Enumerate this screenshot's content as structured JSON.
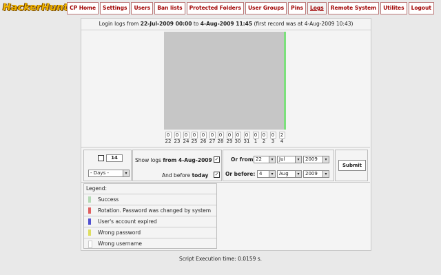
{
  "app": {
    "logo_text": "HackerHunter"
  },
  "nav": [
    {
      "label": "CP Home",
      "active": false
    },
    {
      "label": "Settings",
      "active": false
    },
    {
      "label": "Users",
      "active": false
    },
    {
      "label": "Ban lists",
      "active": false
    },
    {
      "label": "Protected Folders",
      "active": false
    },
    {
      "label": "User Groups",
      "active": false
    },
    {
      "label": "Pins",
      "active": false
    },
    {
      "label": "Logs",
      "active": true
    },
    {
      "label": "Remote System",
      "active": false
    },
    {
      "label": "Utilites",
      "active": false
    },
    {
      "label": "Logout",
      "active": false
    }
  ],
  "header": {
    "prefix": "Login logs from ",
    "from": "22-Jul-2009 00:00",
    "to_word": " to ",
    "to": "4-Aug-2009 11:45",
    "suffix": " (first record was at 4-Aug-2009 10:43)"
  },
  "chart_data": {
    "type": "bar",
    "categories": [
      "22",
      "23",
      "24",
      "25",
      "26",
      "27",
      "28",
      "29",
      "30",
      "31",
      "1",
      "2",
      "3",
      "4"
    ],
    "values": [
      0,
      0,
      0,
      0,
      0,
      0,
      0,
      0,
      0,
      0,
      0,
      0,
      0,
      2
    ],
    "color": "#7de07d",
    "plot_bg": "#c6c6c6"
  },
  "controls": {
    "count_value": "14",
    "period_select": "- Days -",
    "show_logs_label": "Show logs",
    "show_logs_from": "from 4-Aug-2009",
    "and_before_label": "And before",
    "and_before_value": "today",
    "or_from_label": "Or from:",
    "or_from": {
      "day": "22",
      "month": "Jul",
      "year": "2009"
    },
    "or_before_label": "Or before:",
    "or_before": {
      "day": "4",
      "month": "Aug",
      "year": "2009"
    },
    "submit_label": "Submit"
  },
  "legend": {
    "title": "Legend:",
    "items": [
      {
        "label": "Success",
        "color": "#b5d9b5"
      },
      {
        "label": "Rotation. Password was changed by system",
        "color": "#e06060"
      },
      {
        "label": "User's account expired",
        "color": "#5050d0"
      },
      {
        "label": "Wrong password",
        "color": "#dede60"
      },
      {
        "label": "Wrong username",
        "color": "#ffffff"
      }
    ]
  },
  "footer": {
    "text": "Script Execution time: 0.0159 s."
  }
}
